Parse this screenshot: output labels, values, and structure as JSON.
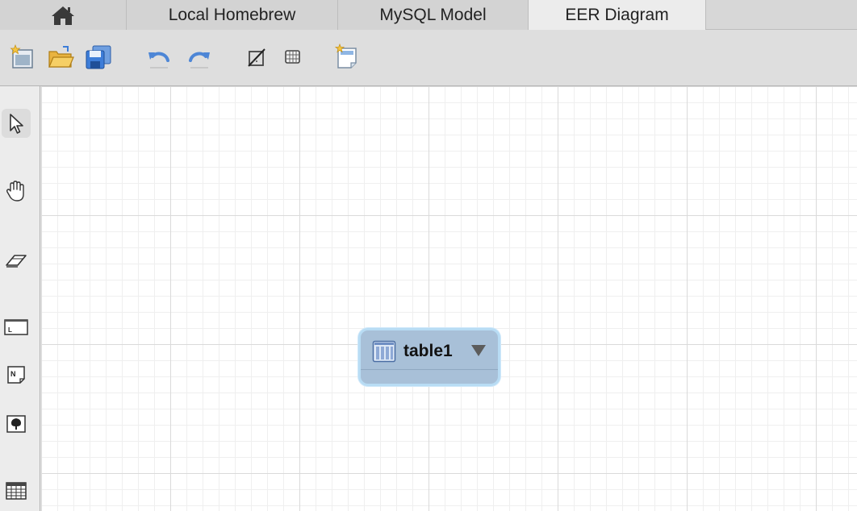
{
  "tabs": [
    {
      "label": "Local Homebrew",
      "active": false
    },
    {
      "label": "MySQL Model",
      "active": false
    },
    {
      "label": "EER Diagram",
      "active": true
    }
  ],
  "icons": {
    "home": "home-icon",
    "toolbar": [
      "new-document-icon",
      "open-folder-icon",
      "save-icon",
      "undo-icon",
      "redo-icon",
      "toggle-grid-icon",
      "align-grid-icon",
      "new-diagram-icon"
    ],
    "palette": [
      "pointer-icon",
      "hand-icon",
      "eraser-icon",
      "layer-icon",
      "note-icon",
      "image-icon",
      "table-icon"
    ]
  },
  "diagram": {
    "table_name": "table1"
  },
  "colors": {
    "table_fill": "#a8c0d8",
    "table_border": "#b8dcf4",
    "accent_blue": "#3d7dd8"
  }
}
